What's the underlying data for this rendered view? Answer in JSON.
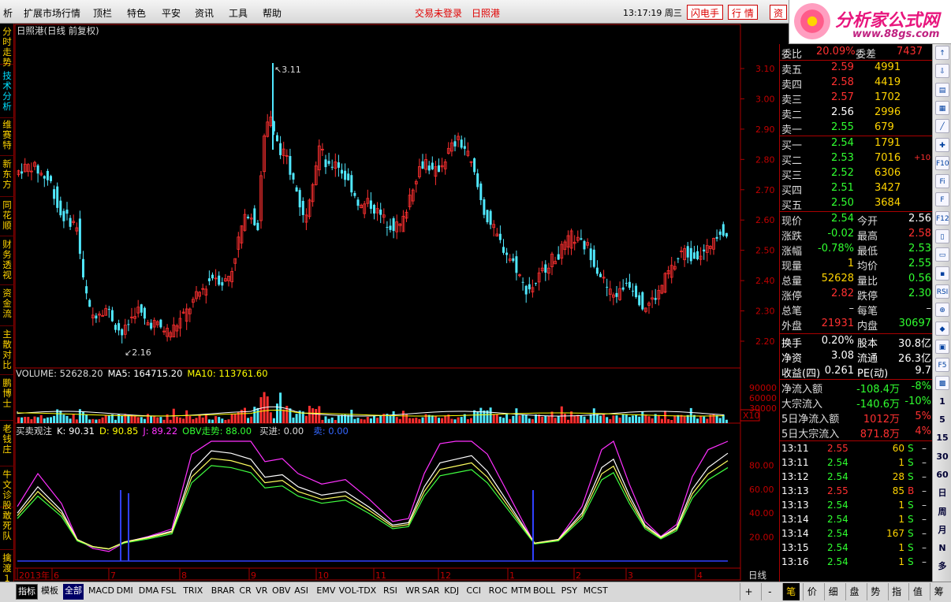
{
  "menu": {
    "items": [
      "析",
      "扩展市场行情",
      "顶栏",
      "特色",
      "平安",
      "资讯",
      "工具",
      "帮助"
    ],
    "login_status": "交易未登录",
    "stock_name": "日照港",
    "clock": "13:17:19 周三",
    "btn_flash": "闪电手",
    "btn_quote": "行 情",
    "btn_info": "资"
  },
  "logo": {
    "main": "分析家公式网",
    "url": "www.88gs.com"
  },
  "left_tabs": [
    {
      "label": "分时走势"
    },
    {
      "label": "技术分析"
    },
    {
      "label": "维赛特"
    },
    {
      "label": "新东方"
    },
    {
      "label": "同花顺"
    },
    {
      "label": "财务透视"
    },
    {
      "label": "资金流"
    },
    {
      "label": "主散对比"
    },
    {
      "label": "鹏博士"
    },
    {
      "label": "老钱庄"
    },
    {
      "label": "牛文诊股"
    },
    {
      "label": "敢死队"
    },
    {
      "label": "擒渡1"
    }
  ],
  "chart": {
    "title": "日照港(日线 前复权)",
    "price_axis": [
      "3.10",
      "3.00",
      "2.90",
      "2.80",
      "2.70",
      "2.60",
      "2.50",
      "2.40",
      "2.30",
      "2.20"
    ],
    "max_label": "3.11",
    "min_label": "2.16",
    "volume": {
      "label": "VOLUME: 52628.20",
      "ma5": "MA5: 164715.20",
      "ma10": "MA10: 113761.60",
      "axis": [
        "90000",
        "60000",
        "30000"
      ],
      "unit": "X10"
    },
    "indicator": {
      "name": "买卖观注",
      "k": "K: 90.31",
      "d": "D: 90.85",
      "j": "J: 89.22",
      "obv": "OBV走势: 88.00",
      "buy": "买进: 0.00",
      "sell": "卖: 0.00",
      "axis": [
        "80.00",
        "60.00",
        "40.00",
        "20.00"
      ]
    },
    "time_axis": [
      "2013年",
      "6",
      "7",
      "8",
      "9",
      "10",
      "11",
      "12",
      "1",
      "2",
      "3",
      "4"
    ],
    "period": "日线",
    "colors": {
      "up": "#ff3030",
      "down": "#50e8ff",
      "k": "#ffffff",
      "d": "#ffff60",
      "j": "#ff30ff",
      "obv": "#40ff40",
      "sig": "#3040ff"
    }
  },
  "quote": {
    "wb_label": "委比",
    "wb": "20.09%",
    "wc_label": "委差",
    "wc": "7437",
    "asks": [
      {
        "label": "卖五",
        "price": "2.59",
        "vol": "4991"
      },
      {
        "label": "卖四",
        "price": "2.58",
        "vol": "4419"
      },
      {
        "label": "卖三",
        "price": "2.57",
        "vol": "1702"
      },
      {
        "label": "卖二",
        "price": "2.56",
        "vol": "2996"
      },
      {
        "label": "卖一",
        "price": "2.55",
        "vol": "679"
      }
    ],
    "bids": [
      {
        "label": "买一",
        "price": "2.54",
        "vol": "1791",
        "chg": ""
      },
      {
        "label": "买二",
        "price": "2.53",
        "vol": "7016",
        "chg": "+10"
      },
      {
        "label": "买三",
        "price": "2.52",
        "vol": "6306",
        "chg": ""
      },
      {
        "label": "买四",
        "price": "2.51",
        "vol": "3427",
        "chg": ""
      },
      {
        "label": "买五",
        "price": "2.50",
        "vol": "3684",
        "chg": ""
      }
    ],
    "stats": [
      {
        "l1": "现价",
        "v1": "2.54",
        "l2": "今开",
        "v2": "2.56"
      },
      {
        "l1": "涨跌",
        "v1": "-0.02",
        "l2": "最高",
        "v2": "2.58"
      },
      {
        "l1": "涨幅",
        "v1": "-0.78%",
        "l2": "最低",
        "v2": "2.53"
      },
      {
        "l1": "现量",
        "v1": "1",
        "l2": "均价",
        "v2": "2.55"
      },
      {
        "l1": "总量",
        "v1": "52628",
        "l2": "量比",
        "v2": "0.56"
      },
      {
        "l1": "涨停",
        "v1": "2.82",
        "l2": "跌停",
        "v2": "2.30"
      },
      {
        "l1": "总笔",
        "v1": "–",
        "l2": "每笔",
        "v2": "–"
      },
      {
        "l1": "外盘",
        "v1": "21931",
        "l2": "内盘",
        "v2": "30697"
      }
    ],
    "fin": [
      {
        "l1": "换手",
        "v1": "0.20%",
        "l2": "股本",
        "v2": "30.8亿"
      },
      {
        "l1": "净资",
        "v1": "3.08",
        "l2": "流通",
        "v2": "26.3亿"
      },
      {
        "l1": "收益(四)",
        "v1": "0.261",
        "l2": "PE(动)",
        "v2": "9.7"
      }
    ],
    "flows": [
      {
        "label": "净流入额",
        "value": "-108.4万",
        "pct": "-8%"
      },
      {
        "label": "大宗流入",
        "value": "-140.6万",
        "pct": "-10%"
      },
      {
        "label": "5日净流入额",
        "value": "1012万",
        "pct": "5%"
      },
      {
        "label": "5日大宗流入",
        "value": "871.8万",
        "pct": "4%"
      }
    ],
    "ticks": [
      {
        "t": "13:11",
        "p": "2.55",
        "v": "60",
        "s": "S"
      },
      {
        "t": "13:11",
        "p": "2.54",
        "v": "1",
        "s": "S"
      },
      {
        "t": "13:12",
        "p": "2.54",
        "v": "28",
        "s": "S"
      },
      {
        "t": "13:13",
        "p": "2.55",
        "v": "85",
        "s": "B"
      },
      {
        "t": "13:13",
        "p": "2.54",
        "v": "1",
        "s": "S"
      },
      {
        "t": "13:14",
        "p": "2.54",
        "v": "1",
        "s": "S"
      },
      {
        "t": "13:14",
        "p": "2.54",
        "v": "167",
        "s": "S"
      },
      {
        "t": "13:15",
        "p": "2.54",
        "v": "1",
        "s": "S"
      },
      {
        "t": "13:16",
        "p": "2.54",
        "v": "1",
        "s": "S"
      }
    ]
  },
  "right_icons": [
    "↑",
    "⇩",
    "▤",
    "▦",
    "╱",
    "✚",
    "F10",
    "Fi",
    "F",
    "F12",
    "▯",
    "▭",
    "▪",
    "RSI",
    "⊕",
    "◆",
    "▣",
    "F5",
    "▩",
    "1",
    "5",
    "15",
    "30",
    "60",
    "日",
    "周",
    "月",
    "N",
    "多"
  ],
  "bottom_tabs": [
    "指标",
    "模板",
    "全部",
    "MACD",
    "DMI",
    "DMA",
    "FSL",
    "TRIX",
    "BRAR",
    "CR",
    "VR",
    "OBV",
    "ASI",
    "EMV",
    "VOL-TDX",
    "RSI",
    "WR",
    "SAR",
    "KDJ",
    "CCI",
    "ROC",
    "MTM",
    "BOLL",
    "PSY",
    "MCST"
  ],
  "bottom_right": [
    "+",
    "-",
    "笔",
    "价",
    "细",
    "盘",
    "势",
    "指",
    "值",
    "筹"
  ]
}
